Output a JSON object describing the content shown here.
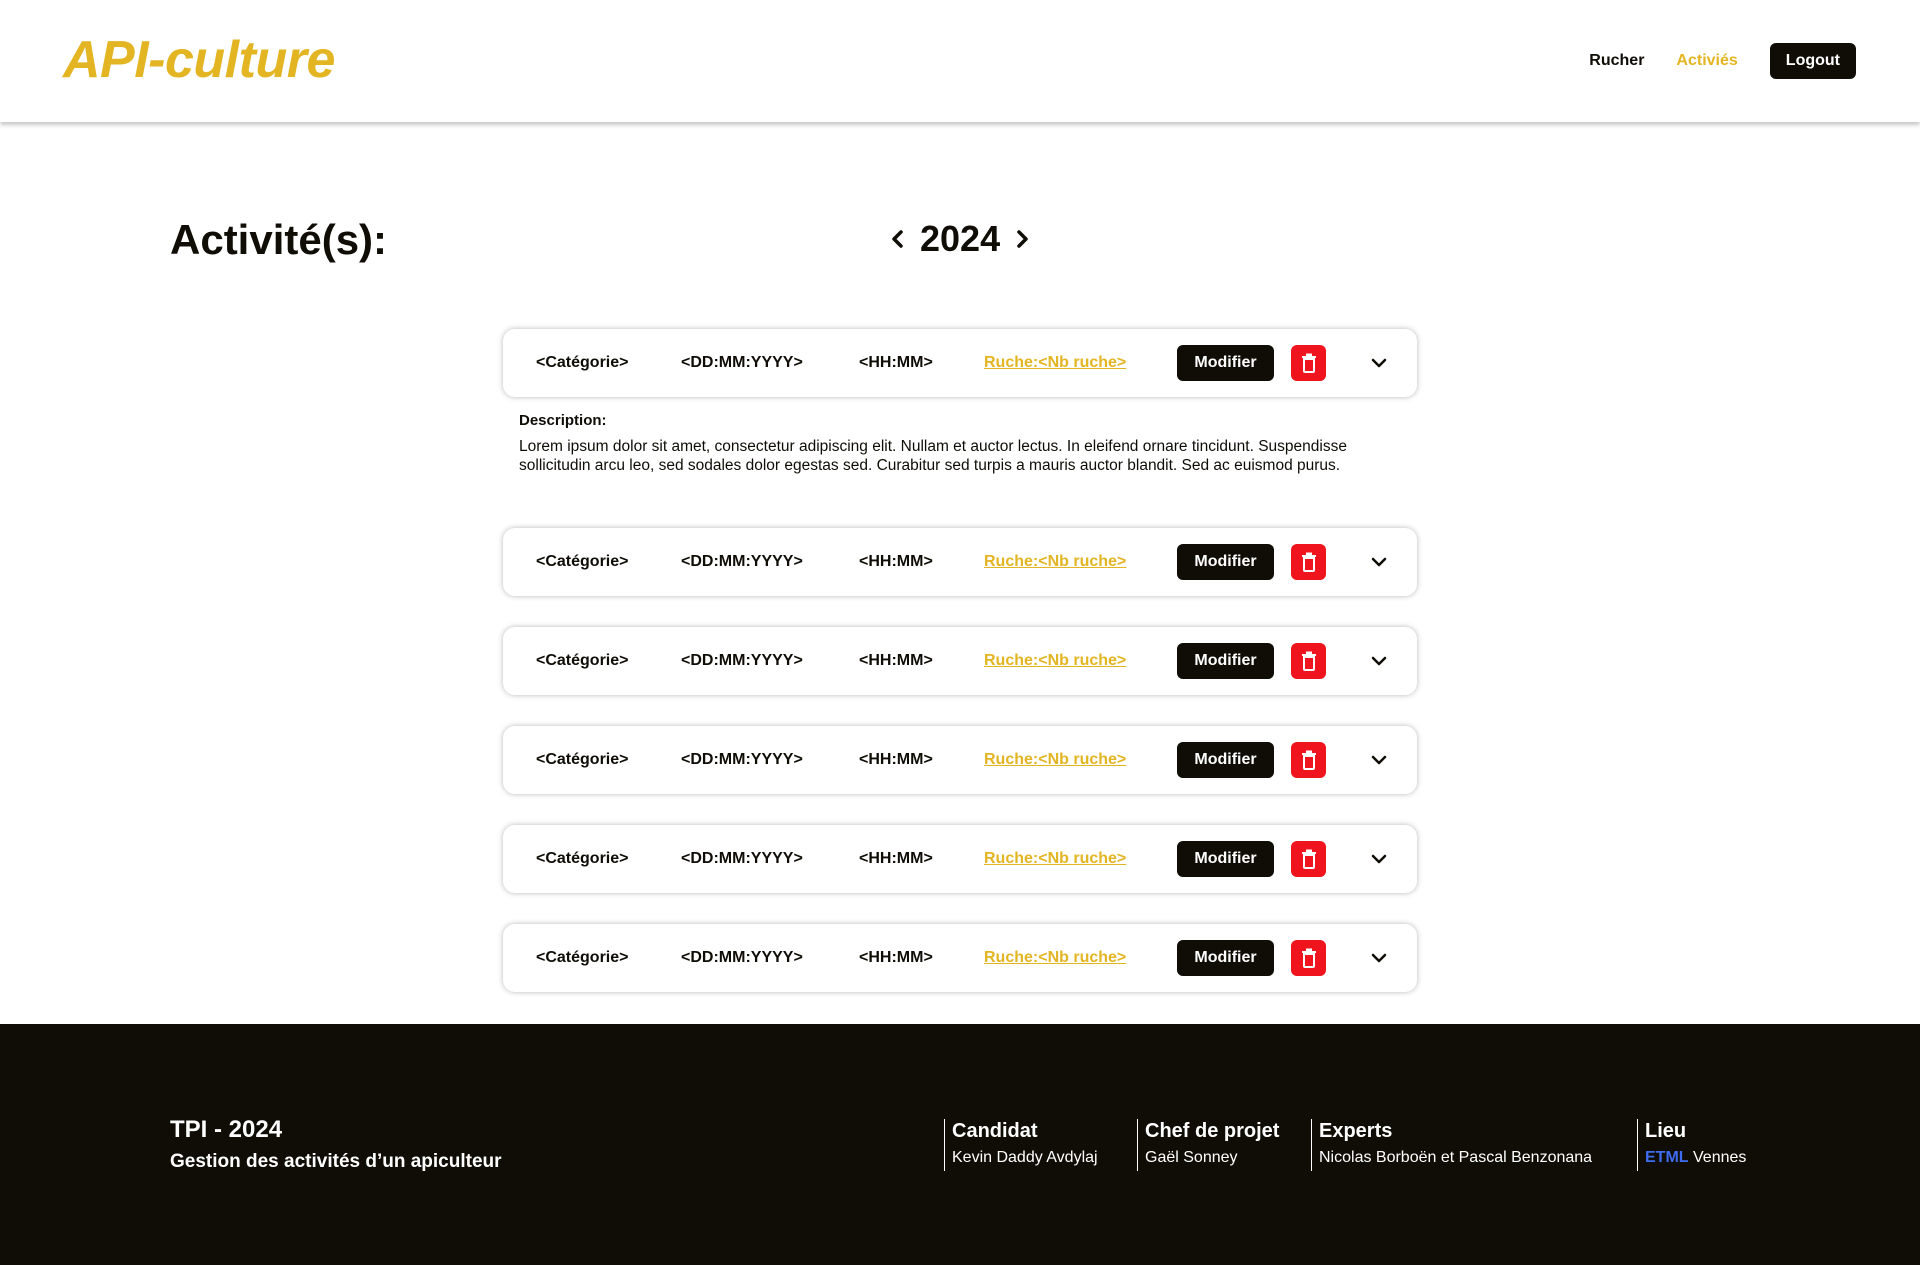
{
  "header": {
    "logo": "API-culture",
    "nav": {
      "rucher": "Rucher",
      "activites": "Activiés",
      "logout": "Logout"
    }
  },
  "page": {
    "title": "Activité(s):",
    "year": "2024"
  },
  "activity_template": {
    "categorie": "<Catégorie>",
    "date": "<DD:MM:YYYY>",
    "time": "<HH:MM>",
    "ruche": "Ruche:<Nb ruche>",
    "modifier": "Modifier"
  },
  "activities": [
    {
      "categorie": "<Catégorie>",
      "date": "<DD:MM:YYYY>",
      "time": "<HH:MM>",
      "ruche": "Ruche:<Nb ruche>",
      "modifier": "Modifier",
      "expanded": true
    },
    {
      "categorie": "<Catégorie>",
      "date": "<DD:MM:YYYY>",
      "time": "<HH:MM>",
      "ruche": "Ruche:<Nb ruche>",
      "modifier": "Modifier"
    },
    {
      "categorie": "<Catégorie>",
      "date": "<DD:MM:YYYY>",
      "time": "<HH:MM>",
      "ruche": "Ruche:<Nb ruche>",
      "modifier": "Modifier"
    },
    {
      "categorie": "<Catégorie>",
      "date": "<DD:MM:YYYY>",
      "time": "<HH:MM>",
      "ruche": "Ruche:<Nb ruche>",
      "modifier": "Modifier"
    },
    {
      "categorie": "<Catégorie>",
      "date": "<DD:MM:YYYY>",
      "time": "<HH:MM>",
      "ruche": "Ruche:<Nb ruche>",
      "modifier": "Modifier"
    },
    {
      "categorie": "<Catégorie>",
      "date": "<DD:MM:YYYY>",
      "time": "<HH:MM>",
      "ruche": "Ruche:<Nb ruche>",
      "modifier": "Modifier"
    }
  ],
  "description": {
    "label": "Description:",
    "text": "Lorem ipsum dolor sit amet, consectetur adipiscing elit. Nullam et  auctor lectus. In eleifend ornare tincidunt. Suspendisse sollicitudin  arcu leo, sed sodales dolor egestas sed. Curabitur sed turpis a mauris  auctor blandit. Sed ac euismod purus."
  },
  "footer": {
    "title": "TPI - 2024",
    "subtitle": "Gestion des activités d’un apiculteur",
    "candidat": {
      "title": "Candidat",
      "value": "Kevin Daddy Avdylaj"
    },
    "chef": {
      "title": "Chef de projet",
      "value": "Gaël Sonney"
    },
    "experts": {
      "title": "Experts",
      "value": "Nicolas Borboën et Pascal Benzonana"
    },
    "lieu": {
      "title": "Lieu",
      "etml": "ETML",
      "value": "Vennes"
    }
  },
  "colors": {
    "accent": "#e3b522",
    "dark": "#0f0d06",
    "danger": "#f0141e",
    "link_blue": "#3d6cf0"
  },
  "icons": {
    "prev": "chevron-left-icon",
    "next": "chevron-right-icon",
    "delete": "trash-icon",
    "expand": "chevron-down-icon"
  }
}
